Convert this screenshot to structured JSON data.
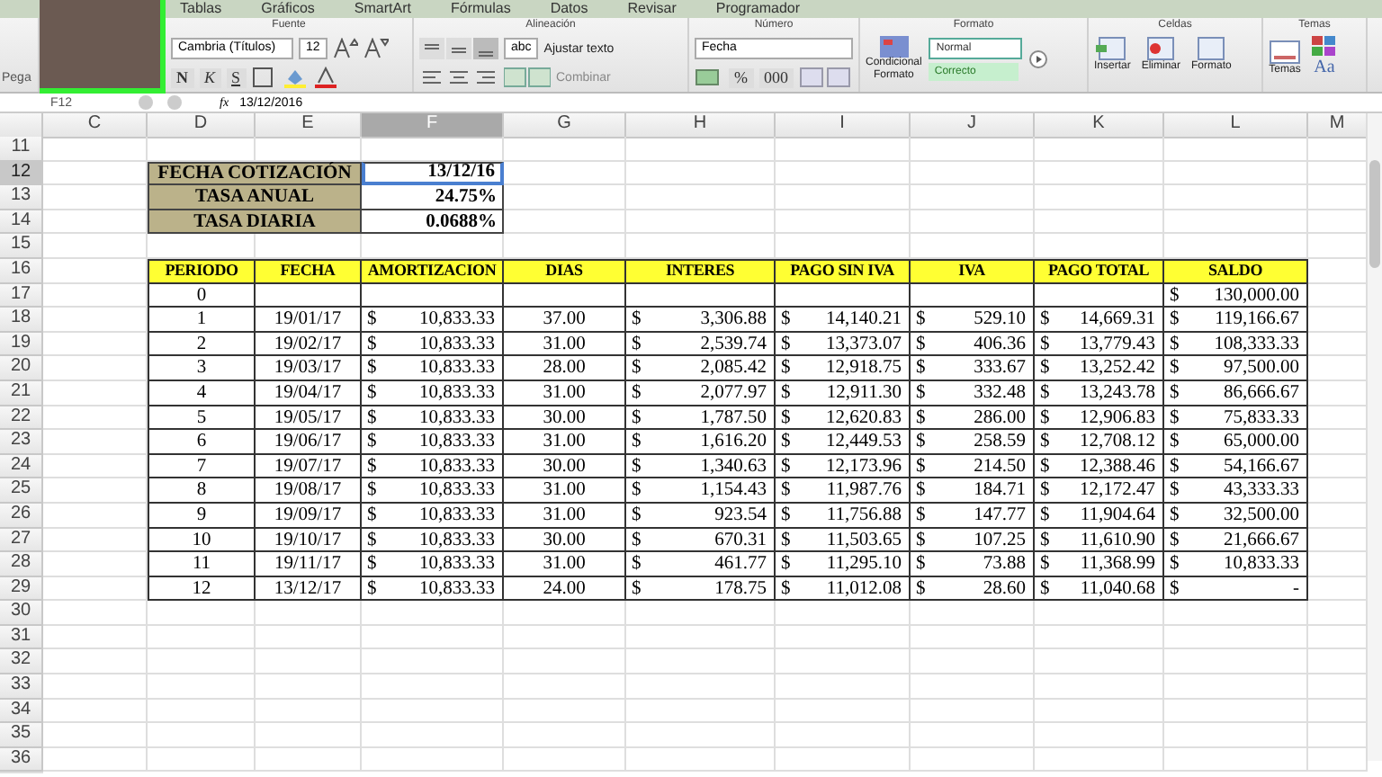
{
  "ribbon": {
    "tabs": [
      "Tablas",
      "Gráficos",
      "SmartArt",
      "Fórmulas",
      "Datos",
      "Revisar",
      "Programador"
    ],
    "paste_label": "Pega",
    "font": {
      "title": "Fuente",
      "font_name": "Cambria (Títulos)",
      "font_size": "12",
      "styles": [
        "N",
        "K",
        "S"
      ]
    },
    "alignment": {
      "title": "Alineación",
      "wrap_style": "abc",
      "wrap_text": "Ajustar texto",
      "merge": "Combinar"
    },
    "number": {
      "title": "Número",
      "format": "Fecha",
      "percent": "%",
      "thousands": "000"
    },
    "format": {
      "title": "Formato",
      "conditional": [
        "Condicional",
        "Formato"
      ],
      "styles": [
        {
          "label": "Normal",
          "selected": true
        },
        {
          "label": "Correcto",
          "selected": false
        }
      ]
    },
    "cells": {
      "title": "Celdas",
      "buttons": [
        "Insertar",
        "Eliminar",
        "Formato"
      ]
    },
    "themes": {
      "title": "Temas",
      "button": "Temas",
      "font_button": "Aa"
    }
  },
  "formula_bar": {
    "cell_ref": "F12",
    "fx": "fx",
    "value": "13/12/2016"
  },
  "sheet": {
    "columns": [
      {
        "label": "C",
        "selected": false
      },
      {
        "label": "D",
        "selected": false
      },
      {
        "label": "E",
        "selected": false
      },
      {
        "label": "F",
        "selected": true
      },
      {
        "label": "G",
        "selected": false
      },
      {
        "label": "H",
        "selected": false
      },
      {
        "label": "I",
        "selected": false
      },
      {
        "label": "J",
        "selected": false
      },
      {
        "label": "K",
        "selected": false
      },
      {
        "label": "L",
        "selected": false
      },
      {
        "label": "M",
        "selected": false
      }
    ],
    "rows": [
      {
        "label": "11",
        "selected": false
      },
      {
        "label": "12",
        "selected": true
      },
      {
        "label": "13",
        "selected": false
      },
      {
        "label": "14",
        "selected": false
      },
      {
        "label": "15",
        "selected": false
      },
      {
        "label": "16",
        "selected": false
      },
      {
        "label": "17",
        "selected": false
      },
      {
        "label": "18",
        "selected": false
      },
      {
        "label": "19",
        "selected": false
      },
      {
        "label": "20",
        "selected": false
      },
      {
        "label": "21",
        "selected": false
      },
      {
        "label": "22",
        "selected": false
      },
      {
        "label": "23",
        "selected": false
      },
      {
        "label": "24",
        "selected": false
      },
      {
        "label": "25",
        "selected": false
      },
      {
        "label": "26",
        "selected": false
      },
      {
        "label": "27",
        "selected": false
      },
      {
        "label": "28",
        "selected": false
      },
      {
        "label": "29",
        "selected": false
      },
      {
        "label": "30",
        "selected": false
      },
      {
        "label": "31",
        "selected": false
      },
      {
        "label": "32",
        "selected": false
      },
      {
        "label": "33",
        "selected": false
      },
      {
        "label": "34",
        "selected": false
      },
      {
        "label": "35",
        "selected": false
      },
      {
        "label": "36",
        "selected": false
      }
    ]
  },
  "summary": [
    {
      "label": "FECHA COTIZACIÓN",
      "value": "13/12/16",
      "selected": true
    },
    {
      "label": "TASA ANUAL",
      "value": "24.75%",
      "selected": false
    },
    {
      "label": "TASA DIARIA",
      "value": "0.0688%",
      "selected": false
    }
  ],
  "table": {
    "columns": [
      "PERIODO",
      "FECHA",
      "AMORTIZACION",
      "DIAS",
      "INTERES",
      "PAGO SIN IVA",
      "IVA",
      "PAGO TOTAL",
      "SALDO"
    ],
    "rows": [
      {
        "cells": [
          "0",
          null,
          null,
          null,
          null,
          null,
          null,
          null,
          [
            "$",
            "130,000.00"
          ]
        ]
      },
      {
        "cells": [
          "1",
          "19/01/17",
          [
            "$",
            "10,833.33"
          ],
          "37.00",
          [
            "$",
            "3,306.88"
          ],
          [
            "$",
            "14,140.21"
          ],
          [
            "$",
            "529.10"
          ],
          [
            "$",
            "14,669.31"
          ],
          [
            "$",
            "119,166.67"
          ]
        ]
      },
      {
        "cells": [
          "2",
          "19/02/17",
          [
            "$",
            "10,833.33"
          ],
          "31.00",
          [
            "$",
            "2,539.74"
          ],
          [
            "$",
            "13,373.07"
          ],
          [
            "$",
            "406.36"
          ],
          [
            "$",
            "13,779.43"
          ],
          [
            "$",
            "108,333.33"
          ]
        ]
      },
      {
        "cells": [
          "3",
          "19/03/17",
          [
            "$",
            "10,833.33"
          ],
          "28.00",
          [
            "$",
            "2,085.42"
          ],
          [
            "$",
            "12,918.75"
          ],
          [
            "$",
            "333.67"
          ],
          [
            "$",
            "13,252.42"
          ],
          [
            "$",
            "97,500.00"
          ]
        ]
      },
      {
        "cells": [
          "4",
          "19/04/17",
          [
            "$",
            "10,833.33"
          ],
          "31.00",
          [
            "$",
            "2,077.97"
          ],
          [
            "$",
            "12,911.30"
          ],
          [
            "$",
            "332.48"
          ],
          [
            "$",
            "13,243.78"
          ],
          [
            "$",
            "86,666.67"
          ]
        ]
      },
      {
        "cells": [
          "5",
          "19/05/17",
          [
            "$",
            "10,833.33"
          ],
          "30.00",
          [
            "$",
            "1,787.50"
          ],
          [
            "$",
            "12,620.83"
          ],
          [
            "$",
            "286.00"
          ],
          [
            "$",
            "12,906.83"
          ],
          [
            "$",
            "75,833.33"
          ]
        ]
      },
      {
        "cells": [
          "6",
          "19/06/17",
          [
            "$",
            "10,833.33"
          ],
          "31.00",
          [
            "$",
            "1,616.20"
          ],
          [
            "$",
            "12,449.53"
          ],
          [
            "$",
            "258.59"
          ],
          [
            "$",
            "12,708.12"
          ],
          [
            "$",
            "65,000.00"
          ]
        ]
      },
      {
        "cells": [
          "7",
          "19/07/17",
          [
            "$",
            "10,833.33"
          ],
          "30.00",
          [
            "$",
            "1,340.63"
          ],
          [
            "$",
            "12,173.96"
          ],
          [
            "$",
            "214.50"
          ],
          [
            "$",
            "12,388.46"
          ],
          [
            "$",
            "54,166.67"
          ]
        ]
      },
      {
        "cells": [
          "8",
          "19/08/17",
          [
            "$",
            "10,833.33"
          ],
          "31.00",
          [
            "$",
            "1,154.43"
          ],
          [
            "$",
            "11,987.76"
          ],
          [
            "$",
            "184.71"
          ],
          [
            "$",
            "12,172.47"
          ],
          [
            "$",
            "43,333.33"
          ]
        ]
      },
      {
        "cells": [
          "9",
          "19/09/17",
          [
            "$",
            "10,833.33"
          ],
          "31.00",
          [
            "$",
            "923.54"
          ],
          [
            "$",
            "11,756.88"
          ],
          [
            "$",
            "147.77"
          ],
          [
            "$",
            "11,904.64"
          ],
          [
            "$",
            "32,500.00"
          ]
        ]
      },
      {
        "cells": [
          "10",
          "19/10/17",
          [
            "$",
            "10,833.33"
          ],
          "30.00",
          [
            "$",
            "670.31"
          ],
          [
            "$",
            "11,503.65"
          ],
          [
            "$",
            "107.25"
          ],
          [
            "$",
            "11,610.90"
          ],
          [
            "$",
            "21,666.67"
          ]
        ]
      },
      {
        "cells": [
          "11",
          "19/11/17",
          [
            "$",
            "10,833.33"
          ],
          "31.00",
          [
            "$",
            "461.77"
          ],
          [
            "$",
            "11,295.10"
          ],
          [
            "$",
            "73.88"
          ],
          [
            "$",
            "11,368.99"
          ],
          [
            "$",
            "10,833.33"
          ]
        ]
      },
      {
        "cells": [
          "12",
          "13/12/17",
          [
            "$",
            "10,833.33"
          ],
          "24.00",
          [
            "$",
            "178.75"
          ],
          [
            "$",
            "11,012.08"
          ],
          [
            "$",
            "28.60"
          ],
          [
            "$",
            "11,040.68"
          ],
          [
            "$",
            "-"
          ]
        ]
      }
    ]
  }
}
